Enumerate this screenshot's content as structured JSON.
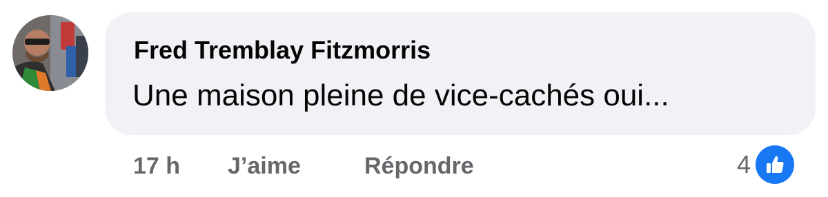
{
  "comment": {
    "author": "Fred Tremblay Fitzmorris",
    "text": "Une maison pleine de vice-cachés oui...",
    "avatar_icon": "profile-photo"
  },
  "actions": {
    "time": "17 h",
    "like_label": "J’aime",
    "reply_label": "Répondre"
  },
  "reactions": {
    "count": "4",
    "icon": "thumbs-up-icon",
    "color": "#1877f2"
  },
  "colors": {
    "bubble": "#f0f2f5",
    "meta": "#65676b",
    "text": "#050505"
  }
}
